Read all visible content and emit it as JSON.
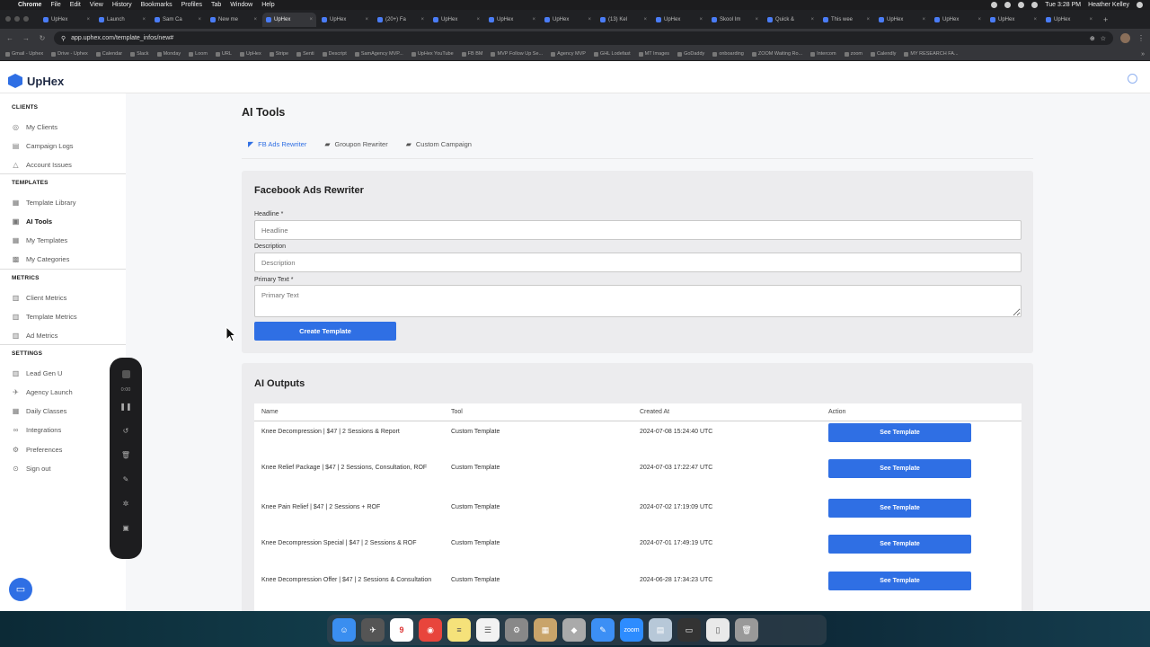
{
  "menubar": {
    "app": "Chrome",
    "items": [
      "File",
      "Edit",
      "View",
      "History",
      "Bookmarks",
      "Profiles",
      "Tab",
      "Window",
      "Help"
    ],
    "clock": "Tue 3:28 PM",
    "user": "Heather Kelley"
  },
  "browser": {
    "tabs": [
      {
        "title": "UpHex"
      },
      {
        "title": "Launch"
      },
      {
        "title": "Sam Ca"
      },
      {
        "title": "New me"
      },
      {
        "title": "UpHex",
        "active": true
      },
      {
        "title": "UpHex"
      },
      {
        "title": "(20+) Fa"
      },
      {
        "title": "UpHex"
      },
      {
        "title": "UpHex"
      },
      {
        "title": "UpHex"
      },
      {
        "title": "(13) Kel"
      },
      {
        "title": "UpHex"
      },
      {
        "title": "Skool Im"
      },
      {
        "title": "Quick &"
      },
      {
        "title": "This wee"
      },
      {
        "title": "UpHex"
      },
      {
        "title": "UpHex"
      },
      {
        "title": "UpHex"
      },
      {
        "title": "UpHex"
      }
    ],
    "url": "app.uphex.com/template_infos/new#",
    "bookmarks": [
      "Gmail - Uphex",
      "Drive - Uphex",
      "Calendar",
      "Slack",
      "Monday",
      "Loom",
      "URL",
      "UpHex",
      "Stripe",
      "Senti",
      "Descript",
      "SamAgency MVP...",
      "UpHex YouTube",
      "FB BM",
      "MVP Follow Up Se...",
      "Agency MVP",
      "GHL Lodefast",
      "MT Images",
      "GoDaddy",
      "onboarding",
      "ZOOM Waiting Ro...",
      "Intercom",
      "zoom",
      "Calendly",
      "MY RESEARCH FA..."
    ]
  },
  "app": {
    "logo_text": "UpHex"
  },
  "sidebar": {
    "clients_title": "CLIENTS",
    "clients": [
      {
        "label": "My Clients",
        "icon": "megaphone-icon",
        "glyph": "◎"
      },
      {
        "label": "Campaign Logs",
        "icon": "logs-icon",
        "glyph": "▤"
      },
      {
        "label": "Account Issues",
        "icon": "warning-icon",
        "glyph": "△"
      }
    ],
    "templates_title": "TEMPLATES",
    "templates": [
      {
        "label": "Template Library",
        "icon": "library-icon",
        "glyph": "▦"
      },
      {
        "label": "AI Tools",
        "icon": "ai-tools-icon",
        "glyph": "▣",
        "active": true
      },
      {
        "label": "My Templates",
        "icon": "templates-icon",
        "glyph": "▦"
      },
      {
        "label": "My Categories",
        "icon": "categories-icon",
        "glyph": "▩"
      }
    ],
    "metrics_title": "METRICS",
    "metrics": [
      {
        "label": "Client Metrics",
        "icon": "bar-chart-icon",
        "glyph": "▥"
      },
      {
        "label": "Template Metrics",
        "icon": "bar-chart-icon",
        "glyph": "▥"
      },
      {
        "label": "Ad Metrics",
        "icon": "bar-chart-icon",
        "glyph": "▥"
      }
    ],
    "settings_title": "SETTINGS",
    "settings": [
      {
        "label": "Lead Gen U",
        "icon": "building-icon",
        "glyph": "▥"
      },
      {
        "label": "Agency Launch",
        "icon": "rocket-icon",
        "glyph": "✈"
      },
      {
        "label": "Daily Classes",
        "icon": "calendar-icon",
        "glyph": "▦"
      },
      {
        "label": "Integrations",
        "icon": "link-icon",
        "glyph": "∞"
      },
      {
        "label": "Preferences",
        "icon": "gear-icon",
        "glyph": "⚙"
      },
      {
        "label": "Sign out",
        "icon": "sign-out-icon",
        "glyph": "⊙"
      }
    ]
  },
  "recorder": {
    "time": "0:00"
  },
  "main": {
    "title": "AI Tools",
    "tabs": [
      {
        "label": "FB Ads Rewriter",
        "active": true
      },
      {
        "label": "Groupon Rewriter"
      },
      {
        "label": "Custom Campaign"
      }
    ],
    "form": {
      "title": "Facebook Ads Rewriter",
      "headline_label": "Headline *",
      "headline_placeholder": "Headline",
      "description_label": "Description",
      "description_placeholder": "Description",
      "primary_label": "Primary Text *",
      "primary_placeholder": "Primary Text",
      "submit_label": "Create Template"
    },
    "outputs": {
      "title": "AI Outputs",
      "columns": [
        "Name",
        "Tool",
        "Created At",
        "Action"
      ],
      "rows": [
        {
          "name": "Knee Decompression | $47 | 2 Sessions & Report",
          "tool": "Custom Template",
          "created_at": "2024-07-08 15:24:40 UTC",
          "action": "See Template"
        },
        {
          "name": "Knee Relief Package | $47 | 2 Sessions, Consultation, ROF",
          "tool": "Custom Template",
          "created_at": "2024-07-03 17:22:47 UTC",
          "action": "See Template"
        },
        {
          "name": "Knee Pain Relief | $47 | 2 Sessions + ROF",
          "tool": "Custom Template",
          "created_at": "2024-07-02 17:19:09 UTC",
          "action": "See Template"
        },
        {
          "name": "Knee Decompression Special | $47 | 2 Sessions & ROF",
          "tool": "Custom Template",
          "created_at": "2024-07-01 17:49:19 UTC",
          "action": "See Template"
        },
        {
          "name": "Knee Decompression Offer | $47 | 2 Sessions & Consultation",
          "tool": "Custom Template",
          "created_at": "2024-06-28 17:34:23 UTC",
          "action": "See Template"
        }
      ]
    }
  },
  "dock": {
    "calendar_day": "9",
    "zoom_label": "zoom"
  },
  "colors": {
    "accent": "#2f6fe4",
    "sidebar_bg": "#ffffff",
    "content_bg": "#f6f7f9",
    "card_bg": "#ececee"
  }
}
